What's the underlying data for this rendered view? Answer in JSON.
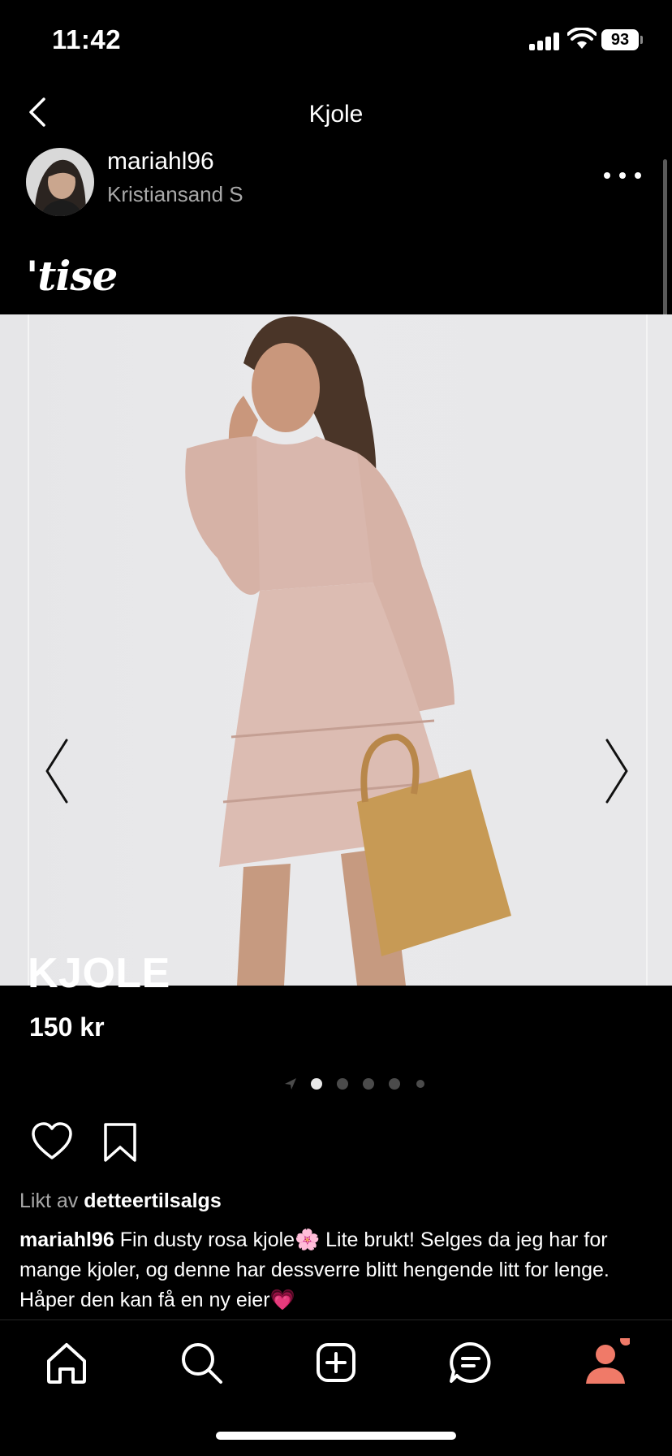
{
  "status_bar": {
    "time": "11:42",
    "battery": "93"
  },
  "header": {
    "title": "Kjole"
  },
  "user": {
    "username": "mariahl96",
    "location": "Kristiansand S"
  },
  "brand": {
    "logo_text": "'tise"
  },
  "product": {
    "title": "KJOLE",
    "price": "150 kr"
  },
  "carousel": {
    "total_images": 5,
    "active_index": 0
  },
  "likes": {
    "prefix": "Likt av",
    "user": "detteertilsalgs"
  },
  "caption": {
    "user": "mariahl96",
    "text": " Fin dusty rosa kjole🌸 Lite brukt! Selges da jeg har for mange kjoler, og denne har dessverre blitt hengende litt for lenge. Håper den kan få en ny eier💗"
  },
  "tab_bar": {
    "items": [
      "home-icon",
      "search-icon",
      "add-icon",
      "messages-icon",
      "profile-icon"
    ],
    "active": "profile-icon",
    "notification_color": "#f07a68"
  },
  "colors": {
    "background": "#000000",
    "accent": "#f07a68",
    "muted_text": "#a8a8a8"
  }
}
